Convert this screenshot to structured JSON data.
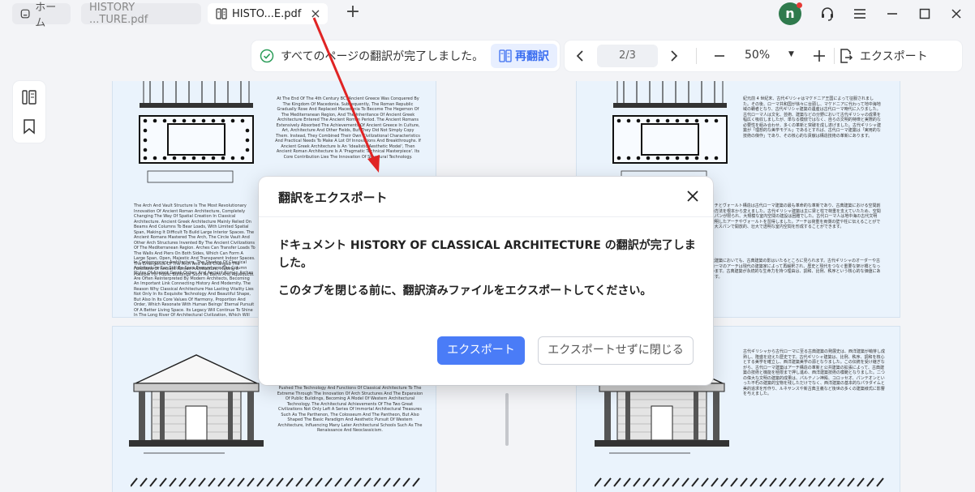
{
  "tabs": {
    "home_label": "ホーム",
    "doc1_label": "HISTORY ...TURE.pdf",
    "doc2_label": "HISTO...E.pdf"
  },
  "user": {
    "avatar_initial": "n"
  },
  "toolbar": {
    "status_text": "すべてのページの翻訳が完了しました。",
    "retranslate_label": "再翻訳",
    "page_indicator": "2/3",
    "zoom": "50%",
    "export_label": "エクスポート"
  },
  "document": {
    "page1_text_right": "At The End Of The 4th Century BC, Ancient Greece Was Conquered By The Kingdom Of Macedonia. Subsequently, The Roman Republic Gradually Rose And Replaced Macedonia To Become The Hegemon Of The Mediterranean Region, And The Inheritance Of Ancient Greek Architecture Entered The Ancient Roman Period. The Ancient Romans Extensively Absorbed The Achievements Of Ancient Greece In Culture, Art, Architecture And Other Fields, But They Did Not Simply Copy Them. Instead, They Combined Their Own Civilizational Characteristics And Practical Needs To Make A Lot Of Innovations And Breakthroughs. If Ancient Greek Architecture Is An 'Idealistic Aesthetic Model', Then Ancient Roman Architecture Is A 'Pragmatic Technical Masterpiece'. Its Core Contribution Lies The Innovation Of Structural Technology.",
    "page1_text_bottom": "The Arch And Vault Structure Is The Most Revolutionary Innovation Of Ancient Roman Architecture, Completely Changing The Way Of Spatial Creation In Classical Architecture. Ancient Greek Architecture Mainly Relied On Beams And Columns To Bear Loads, With Limited Spatial Span, Making It Difficult To Build Large Interior Spaces. The Ancient Romans Mastered The Arch, The Circle Vault And Other Arch Structures Invented By The Ancient Civilizations Of The Mediterranean Region. Arches Can Transfer Loads To The Walls And Piers On Both Sides, Which Can Form A Large Span, Open, Majestic And Transparent Indoor Spaces. The Emergence Of The Arch And Vault Changed The Functions Of Ancient Roman Architecture, Making It Possible For Public Buildings Such As Baths And Aqueducts.",
    "page1_text_bottom2": "In Contemporary Architecture, The Shadow Of Classical Architecture Can Still Be Seen Everywhere. The Column Styles Of Ancient Greek Orders And Ancient Roman Arches Are Often Reinterpreted By Modern Architects, Becoming An Important Link Connecting History And Modernity. The Reason Why Classical Architecture Has Lasting Vitality Lies Not Only In Its Exquisite Technology And Beautiful Shape, But Also In Its Core Values Of Harmony, Proportion And Order, Which Resonate With Human Beings' Eternal Pursuit Of A Better Living Space. Its Legacy Will Continue To Shine In The Long River Of Architectural Civilization, Which Will Always Guide The Development Of Architecture.",
    "page2_text": "紀元前 4 世紀末、古代ギリシャはマケドニア王国によって征服されました。その後、ローマ共和国が徐々に台頭し、マケドニアに代わって地中海地域の覇者となり、古代ギリシャ建築の遺産は古代ローマ時代に入りました。古代ローマ人は文化、芸術、建築などの分野において古代ギリシャの成果を幅広く吸収しましたが、単なる模倣ではなく、自らの文明的特徴と実際的な必要性を組み合わせ、多くの革新と突破を成し遂げました。古代ギリシャ建築が「理想的な美学モデル」であるとすれば、古代ローマ建築は「実用的な技術の傑作」であり、その核心的な貢献は構造技術の革新にあります。",
    "page2_text_mid": "アーチとヴォールト構造は古代ローマ建築の最も革命的な革新であり、古典建築における空間創造の方法を根本から変えました。古代ギリシャ建築は主に梁と柱で荷重を支えていたため、空間のスパンが限られ、大規模な室内空間の建設は困難でした。古代ローマ人は地中海の古代文明が発明したアーチやヴォールトを習得しました。アーチは荷重を両側の壁や柱に伝えることができ、大スパンで開放的、壮大で透明な室内空間を形成することができます。",
    "page2_text_mid2": "現代建築においても、古典建築の影はいたるところに見られます。古代ギリシャのオーダーや古代ローマのアーチは現代の建築家によって再解釈され、歴史と現代をつなぐ重要な架け橋となっています。古典建築が永続的な生命力を持つ理由は、調和、比例、秩序という核心的な価値にあります。",
    "page3_text": "The Building, Becoming The Source Of Western Architectural Aesthetics; On The Basis Of Inheriting This Tradition, Ancient Roman Architecture Pushed The Technology And Functions Of Classical Architecture To The Extreme Through The Innovation Of Arch Structures And The Expansion Of Public Buildings, Becoming A Model Of Western Architectural Technology. The Architectural Achievements Of The Two Great Civilizations Not Only Left A Series Of Immortal Architectural Treasures Such As The Parthenon, The Colosseum And The Pantheon, But Also Shaped The Basic Paradigm And Aesthetic Pursuit Of Western Architecture, Influencing Many Later Architectural Schools Such As The Renaissance And Neoclassicism.",
    "page4_text": "古代ギリシャから古代ローマに至る古典建築の発展史は、西洋建築が萌芽し成熟し、隆盛を迎えた歴史です。古代ギリシャ建築は、比例、秩序、調和を核心とする美学を確立し、西洋建築美学の源となりました。この伝統を受け継ぎながら、古代ローマ建築はアーチ構造の革新と公共建築の拡張によって、古典建築の技術と機能を極限まで押し進め、西洋建築技術の模範となりました。二つの偉大な文明の建築的成果は、パルテノン神殿、コロッセオ、パンテオンといった不朽の建築的宝物を残しただけでなく、西洋建築の基本的なパラダイムと美的追求を形作り、ルネサンスや新古典主義など後世の多くの建築様式に影響を与えました。"
  },
  "dialog": {
    "title": "翻訳をエクスポート",
    "message_line1": "ドキュメント HISTORY OF CLASSICAL ARCHITECTURE の翻訳が完了しました。",
    "message_line2": "このタブを閉じる前に、翻訳済みファイルをエクスポートしてください。",
    "export_button": "エクスポート",
    "close_without_export_button": "エクスポートせずに閉じる"
  },
  "colors": {
    "accent": "#4a7cf7",
    "retranslate_text": "#3b6ef0",
    "success_check": "#2e9e5b",
    "avatar_bg": "#2f7a4d",
    "annotation_arrow": "#e02424",
    "page_bg": "#eaf3fc"
  },
  "icons": {
    "home": "home-icon",
    "doc": "document-translate-icon",
    "support": "headset-icon",
    "menu": "hamburger-menu-icon",
    "check": "check-circle-icon",
    "export": "export-file-icon",
    "thumbnails": "thumbnails-icon",
    "bookmark": "bookmark-icon"
  }
}
